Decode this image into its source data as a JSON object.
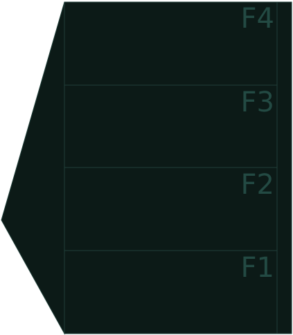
{
  "colors": {
    "panel_fill": "#0c1a17",
    "panel_stroke": "#1f3e38",
    "label_color": "#234a43",
    "background": "#ffffff"
  },
  "floors": [
    {
      "label": "F4"
    },
    {
      "label": "F3"
    },
    {
      "label": "F2"
    },
    {
      "label": "F1"
    }
  ]
}
